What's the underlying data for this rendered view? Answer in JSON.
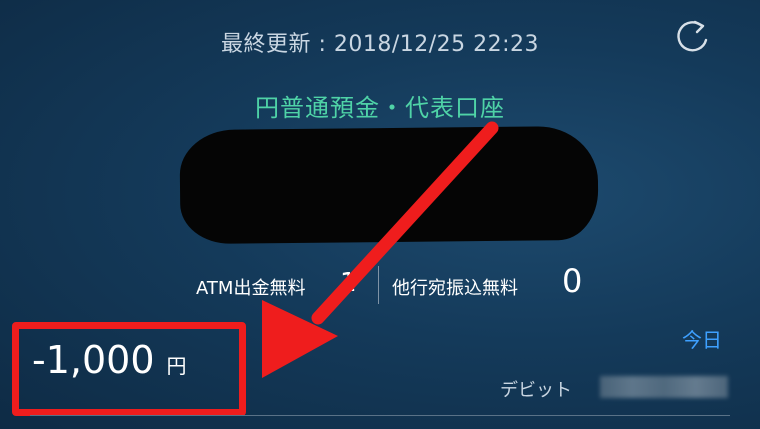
{
  "header": {
    "last_updated": "最終更新 : 2018/12/25 22:23",
    "refresh_icon": "refresh-icon"
  },
  "account": {
    "name": "円普通預金・代表口座"
  },
  "fees": {
    "atm_label": "ATM出金無料",
    "atm_value": "1",
    "transfer_label": "他行宛振込無料",
    "transfer_value": "0"
  },
  "transaction": {
    "date_label": "今日",
    "amount": "-1,000",
    "currency": "円",
    "type": "デビット"
  },
  "colors": {
    "accent_green": "#4fd3a7",
    "link_blue": "#3ea0ff",
    "annotation_red": "#ef1d1d"
  }
}
